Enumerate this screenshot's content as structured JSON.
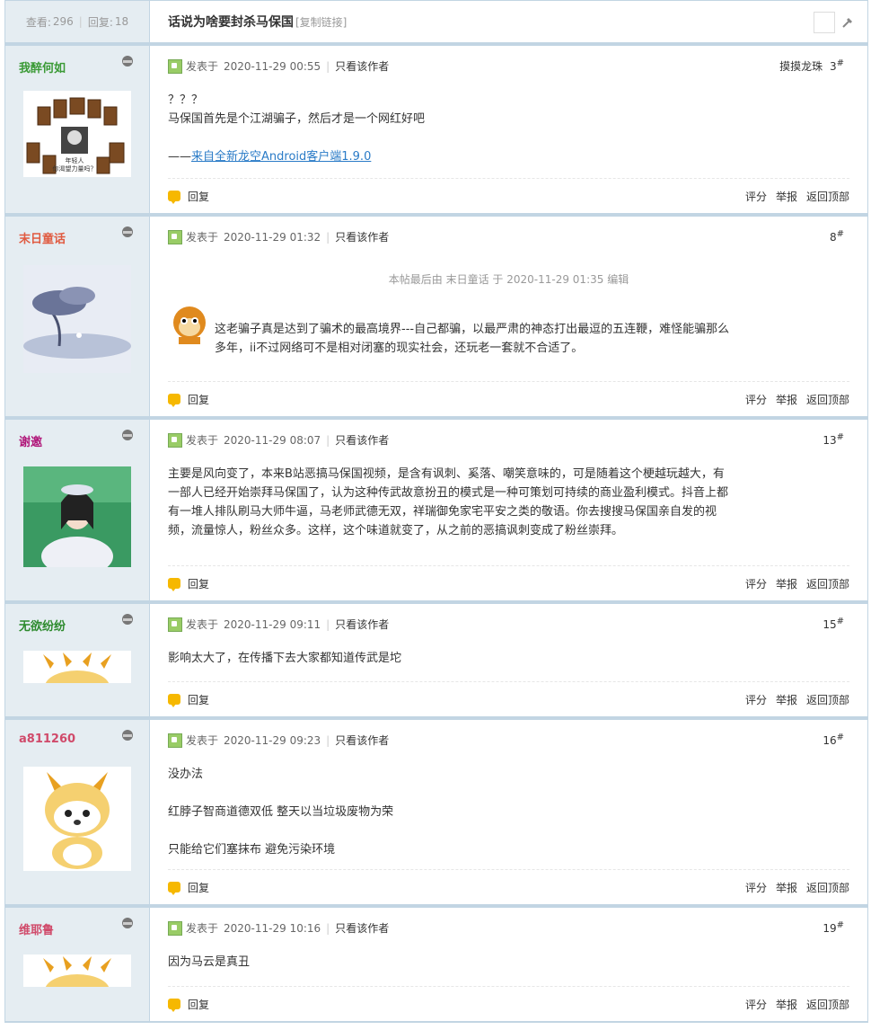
{
  "thread": {
    "views_label": "查看:",
    "views": "296",
    "replies_label": "回复:",
    "replies": "18",
    "title": "话说为啥要封杀马保国",
    "copy_link": "[复制链接]"
  },
  "labels": {
    "posted_prefix": "发表于",
    "only_author": "只看该作者",
    "reply": "回复",
    "rate": "评分",
    "report": "举报",
    "top": "返回顶部"
  },
  "posts": [
    {
      "username": "我醉何如",
      "username_color": "#3a9a35",
      "time": "2020-11-29 00:55",
      "floor_text": "摸摸龙珠",
      "floor": "3",
      "lines": [
        "？？？",
        "马保国首先是个江湖骗子，然后才是一个网红好吧"
      ],
      "source_prefix": "——",
      "source_link": "来自全新龙空Android客户端1.9.0"
    },
    {
      "username": "末日童话",
      "username_color": "#e05a40",
      "time": "2020-11-29 01:32",
      "floor": "8",
      "edit_note": "本帖最后由 末日童话 于 2020-11-29 01:35 编辑",
      "text": "这老骗子真是达到了骗术的最高境界---自己都骗，以最严肃的神态打出最逗的五连鞭，难怪能骗那么多年，ii不过网络可不是相对闭塞的现实社会，还玩老一套就不合适了。"
    },
    {
      "username": "谢邀",
      "username_color": "#b0187a",
      "time": "2020-11-29 08:07",
      "floor": "13",
      "text": "主要是风向变了，本来B站恶搞马保国视频，是含有讽刺、奚落、嘲笑意味的，可是随着这个梗越玩越大，有一部人已经开始崇拜马保国了，认为这种传武故意扮丑的模式是一种可策划可持续的商业盈利模式。抖音上都有一堆人排队刷马大师牛逼，马老师武德无双，祥瑞御免家宅平安之类的敬语。你去搜搜马保国亲自发的视频，流量惊人，粉丝众多。这样，这个味道就变了，从之前的恶搞讽刺变成了粉丝崇拜。"
    },
    {
      "username": "无欲纷纷",
      "username_color": "#2d8a2d",
      "time": "2020-11-29 09:11",
      "floor": "15",
      "text": "影响太大了，在传播下去大家都知道传武是坨"
    },
    {
      "username": "a811260",
      "username_color": "#d04a6a",
      "time": "2020-11-29 09:23",
      "floor": "16",
      "lines": [
        "没办法",
        "红脖子智商道德双低 整天以当垃圾废物为荣",
        "只能给它们塞抹布 避免污染环境"
      ]
    },
    {
      "username": "维耶鲁",
      "username_color": "#d04a6a",
      "time": "2020-11-29 10:16",
      "floor": "19",
      "text": "因为马云是真丑"
    }
  ],
  "avatar1": {
    "caption1": "年轻人",
    "caption2": "你渴望力量吗？"
  }
}
